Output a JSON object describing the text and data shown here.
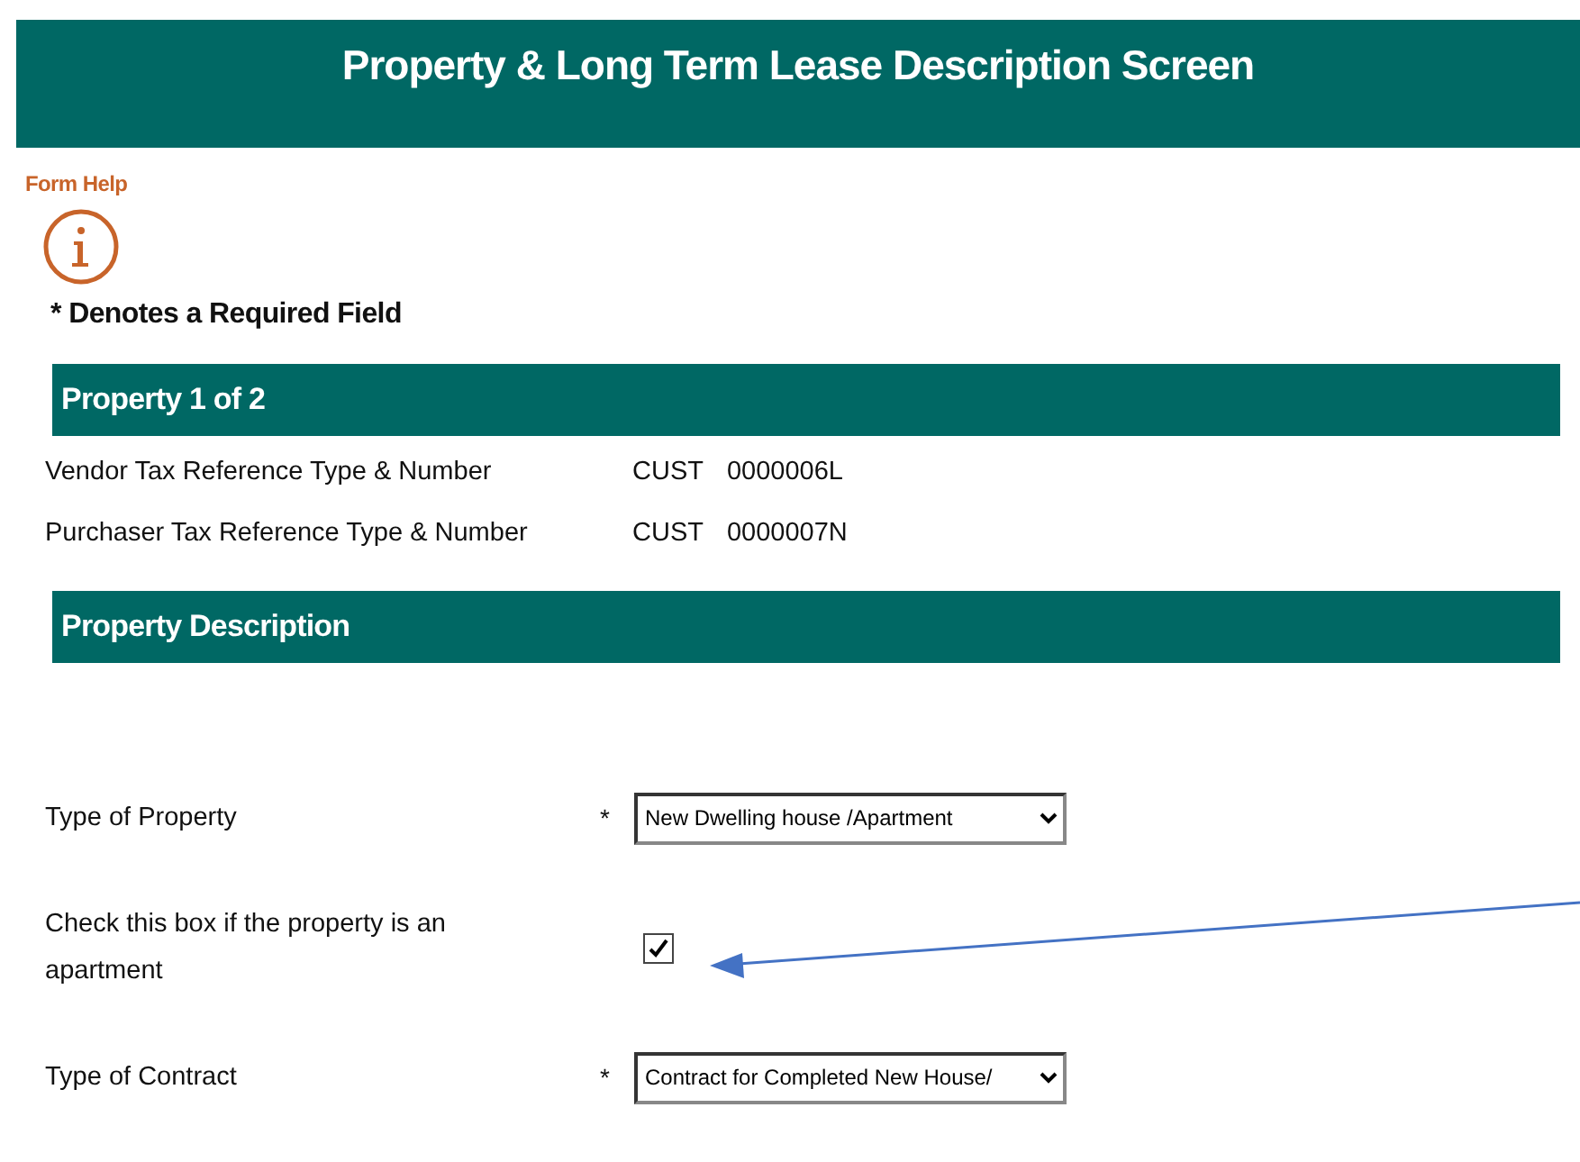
{
  "header": {
    "title": "Property & Long Term Lease Description Screen"
  },
  "form_help": {
    "label": "Form Help"
  },
  "required_note": "* Denotes a Required Field",
  "sections": [
    {
      "kind": "info",
      "title": "Property 1 of 2",
      "rows": [
        {
          "label": "Vendor Tax Reference Type & Number",
          "type": "CUST",
          "number": "0000006L"
        },
        {
          "label": "Purchaser Tax Reference Type & Number",
          "type": "CUST",
          "number": "0000007N"
        }
      ]
    },
    {
      "kind": "form",
      "title": "Property Description",
      "fields": [
        {
          "kind": "select",
          "label": "Type of Property",
          "marker": "*",
          "value": "New Dwelling house /Apartment"
        },
        {
          "kind": "checkbox",
          "label": "Check this box if the property is an apartment",
          "checked": true
        },
        {
          "kind": "select",
          "label": "Type of Contract",
          "marker": "*",
          "value": "Contract for Completed New House/"
        }
      ]
    }
  ]
}
